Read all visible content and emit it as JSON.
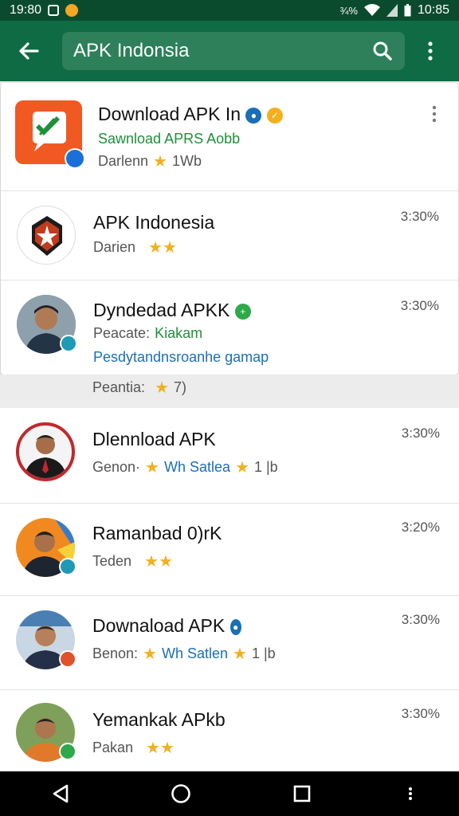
{
  "status_bar": {
    "time_left": "19:80",
    "time_right": "10:85",
    "signal_text": "¾%"
  },
  "search": {
    "query": "APK Indonsia"
  },
  "colors": {
    "app_bar": "#0e6b43",
    "status_bar": "#0b4b2d",
    "star": "#f2b01e",
    "green_text": "#1f8f3a",
    "blue_text": "#1a6fb5"
  },
  "results": [
    {
      "title": "Download APK In",
      "line1": "Sawnload APRS Aobb",
      "line2_label": "Darlenn",
      "line2_value": "1Wb",
      "stars": 1
    },
    {
      "title": "APK Indonesia",
      "time": "3:30%",
      "line1_label": "Darien",
      "stars": 2
    },
    {
      "title": "Dyndedad APKK",
      "time": "3:30%",
      "line1_label": "Peacate:",
      "line1_value": "Kiakam",
      "line2": "Pesdytandnsroanhe gamap"
    }
  ],
  "section": {
    "label": "Peantia:",
    "value": "7)"
  },
  "lower_results": [
    {
      "title": "Dlennload  APK",
      "time": "3:30%",
      "label": "Genon·",
      "mid": "Wh  Satlea",
      "value": "1 |b"
    },
    {
      "title": "Ramanbad 0)rK",
      "time": "3:20%",
      "label": "Teden"
    },
    {
      "title": "Downaload APK",
      "time": "3:30%",
      "label": "Benon:",
      "mid": "Wh  Satlen",
      "value": "1 |b"
    },
    {
      "title": "Yemankak APkb",
      "time": "3:30%",
      "label": "Pakan"
    }
  ]
}
